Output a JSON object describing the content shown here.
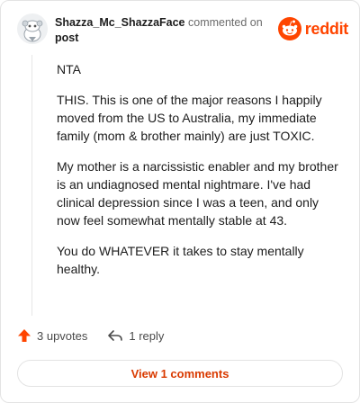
{
  "comment": {
    "username": "Shazza_Mc_ShazzaFace",
    "commented_text": "commented on",
    "post_link": "post",
    "paragraphs": [
      "NTA",
      "THIS. This is one of the major reasons I happily moved from the US to Australia, my immediate family (mom & brother mainly) are just TOXIC.",
      "My mother is a narcissistic enabler and my brother is an undiagnosed mental nightmare. I've had clinical depression since I was a teen, and only now feel somewhat mentally stable at 43.",
      "You do WHATEVER it takes to stay mentally healthy."
    ]
  },
  "brand": {
    "wordmark": "reddit",
    "icon": "reddit-logo-icon",
    "color": "#ff4500"
  },
  "actions": {
    "upvotes": "3 upvotes",
    "upvote_icon": "upvote-arrow-icon",
    "upvote_color": "#ff4500",
    "reply": "1 reply",
    "reply_icon": "reply-arrow-icon"
  },
  "view_comments": "View 1 comments",
  "accent": "#d93a00"
}
